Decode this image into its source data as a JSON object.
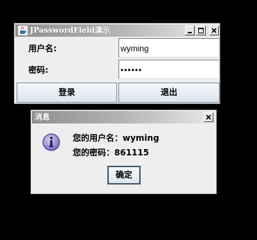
{
  "main_window": {
    "title": "JPasswordField演示",
    "username_label": "用户名:",
    "username_value": "wyming",
    "password_label": "密码:",
    "password_value": "••••••",
    "login_button": "登录",
    "exit_button": "退出"
  },
  "dialog": {
    "title": "消息",
    "line1": "您的用户名：wyming",
    "line2": "您的密码：861115",
    "ok_button": "确定"
  },
  "icons": {
    "app": "java-cup-icon",
    "minimize": "minimize-icon",
    "maximize": "maximize-icon",
    "close": "close-icon",
    "message": "information-icon"
  },
  "colors": {
    "background": "#000000",
    "window": "#eeeeee",
    "button_border": "#7a8a99",
    "info_icon": "#7d6cc6"
  }
}
